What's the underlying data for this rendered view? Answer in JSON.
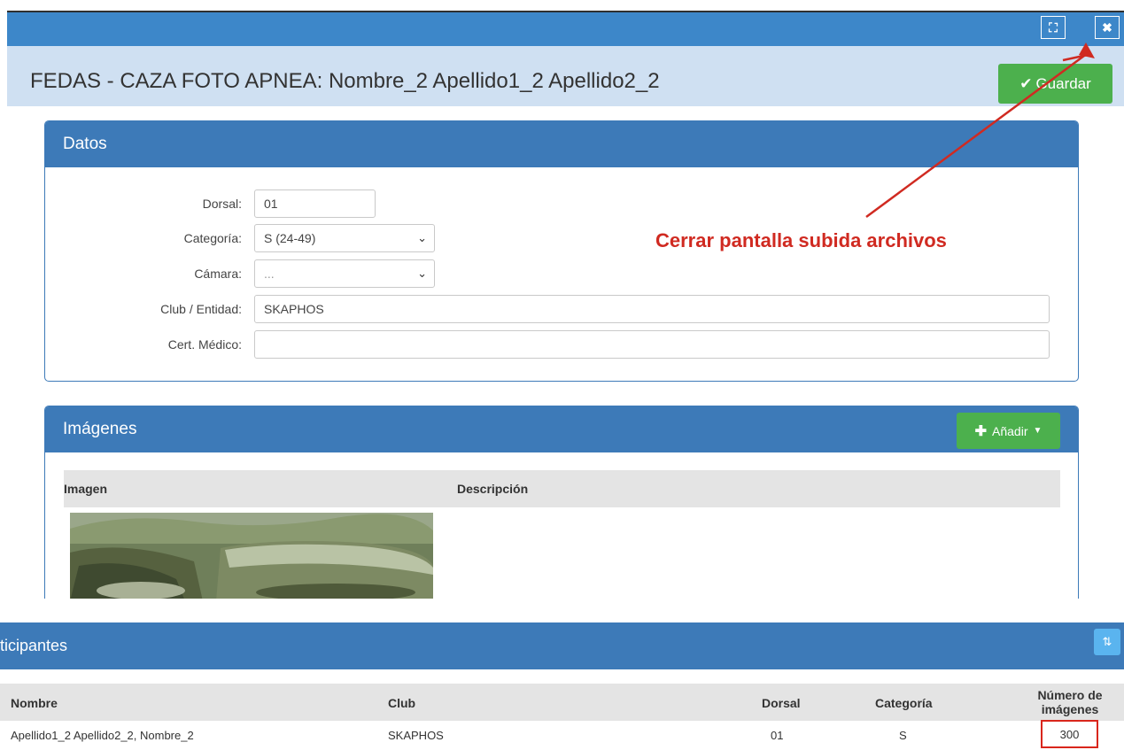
{
  "modal": {
    "title": "FEDAS - CAZA FOTO APNEA: Nombre_2 Apellido1_2 Apellido2_2",
    "save_label": "Guardar",
    "maximize_icon": "expand-icon",
    "close_icon": "close-icon"
  },
  "datos": {
    "heading": "Datos",
    "fields": [
      {
        "label": "Dorsal:",
        "value": "01"
      },
      {
        "label": "Categoría:",
        "value": "S (24-49)"
      },
      {
        "label": "Cámara:",
        "value": "..."
      },
      {
        "label": "Club / Entidad:",
        "value": "SKAPHOS"
      },
      {
        "label": "Cert. Médico:",
        "value": ""
      }
    ]
  },
  "imagenes": {
    "heading": "Imágenes",
    "add_label": "Añadir",
    "columns": [
      "Imagen",
      "Descripción"
    ]
  },
  "annotation": {
    "text": "Cerrar pantalla subida archivos",
    "color": "#d02a21"
  },
  "participantes": {
    "heading": "ticipantes",
    "columns": {
      "nombre": "Nombre",
      "club": "Club",
      "dorsal": "Dorsal",
      "categoria": "Categoría",
      "numero_line1": "Número de",
      "numero_line2": "imágenes"
    },
    "rows": [
      {
        "nombre": "Apellido1_2 Apellido2_2, Nombre_2",
        "club": "SKAPHOS",
        "dorsal": "01",
        "categoria": "S",
        "numero": "300"
      }
    ]
  },
  "colors": {
    "header_blue": "#3d7ab8",
    "title_band": "#cfe0f2",
    "success_green": "#4cb04d",
    "highlight_red": "#d9261c"
  }
}
